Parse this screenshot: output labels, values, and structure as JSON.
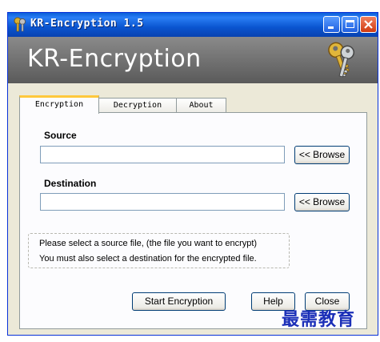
{
  "window": {
    "title": "KR-Encryption 1.5",
    "buttons": {
      "minimize": "_",
      "maximize": "□",
      "close": "✕"
    }
  },
  "banner": {
    "title": "KR-Encryption",
    "icon": "keys-icon"
  },
  "tabs": [
    {
      "label": "Encryption",
      "active": true
    },
    {
      "label": "Decryption",
      "active": false
    },
    {
      "label": "About",
      "active": false
    }
  ],
  "source": {
    "label": "Source",
    "value": "",
    "browse": "<< Browse"
  },
  "destination": {
    "label": "Destination",
    "value": "",
    "browse": "<< Browse"
  },
  "info": {
    "line1": "Please select a source file, (the file you want to encrypt)",
    "line2": "You must also select a destination for the encrypted file."
  },
  "actions": {
    "start": "Start Encryption",
    "help": "Help",
    "close": "Close"
  },
  "watermark": "最需教育",
  "colors": {
    "titlebar": "#0a5ed8",
    "banner": "#6f6f6f",
    "tab_highlight": "#ffc83c",
    "watermark": "#1b2fb8"
  }
}
